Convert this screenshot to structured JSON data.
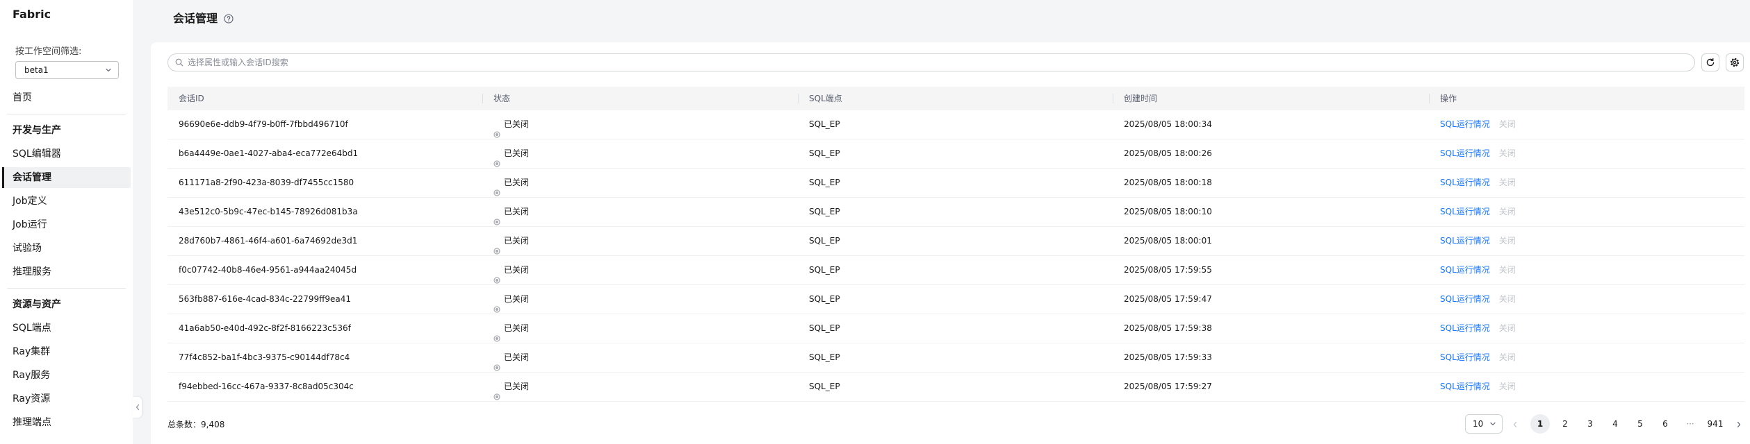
{
  "app": {
    "title": "Fabric"
  },
  "sidebar": {
    "workspace_filter_label": "按工作空间筛选:",
    "workspace_selected": "beta1",
    "home": "首页",
    "groups": [
      {
        "title": "开发与生产",
        "items": [
          {
            "label": "SQL编辑器",
            "active": false
          },
          {
            "label": "会话管理",
            "active": true
          },
          {
            "label": "Job定义",
            "active": false
          },
          {
            "label": "Job运行",
            "active": false
          },
          {
            "label": "试验场",
            "active": false
          },
          {
            "label": "推理服务",
            "active": false
          }
        ]
      },
      {
        "title": "资源与资产",
        "items": [
          {
            "label": "SQL端点",
            "active": false
          },
          {
            "label": "Ray集群",
            "active": false
          },
          {
            "label": "Ray服务",
            "active": false
          },
          {
            "label": "Ray资源",
            "active": false
          },
          {
            "label": "推理端点",
            "active": false
          }
        ]
      }
    ]
  },
  "page": {
    "title": "会话管理"
  },
  "search": {
    "placeholder": "选择属性或输入会话ID搜索"
  },
  "table": {
    "columns": [
      "会话ID",
      "状态",
      "SQL端点",
      "创建时间",
      "操作"
    ],
    "actions": {
      "sql_run": "SQL运行情况",
      "close": "关闭"
    },
    "rows": [
      {
        "id": "96690e6e-ddb9-4f79-b0ff-7fbbd496710f",
        "status": "已关闭",
        "endpoint": "SQL_EP",
        "created": "2025/08/05 18:00:34"
      },
      {
        "id": "b6a4449e-0ae1-4027-aba4-eca772e64bd1",
        "status": "已关闭",
        "endpoint": "SQL_EP",
        "created": "2025/08/05 18:00:26"
      },
      {
        "id": "611171a8-2f90-423a-8039-df7455cc1580",
        "status": "已关闭",
        "endpoint": "SQL_EP",
        "created": "2025/08/05 18:00:18"
      },
      {
        "id": "43e512c0-5b9c-47ec-b145-78926d081b3a",
        "status": "已关闭",
        "endpoint": "SQL_EP",
        "created": "2025/08/05 18:00:10"
      },
      {
        "id": "28d760b7-4861-46f4-a601-6a74692de3d1",
        "status": "已关闭",
        "endpoint": "SQL_EP",
        "created": "2025/08/05 18:00:01"
      },
      {
        "id": "f0c07742-40b8-46e4-9561-a944aa24045d",
        "status": "已关闭",
        "endpoint": "SQL_EP",
        "created": "2025/08/05 17:59:55"
      },
      {
        "id": "563fb887-616e-4cad-834c-22799ff9ea41",
        "status": "已关闭",
        "endpoint": "SQL_EP",
        "created": "2025/08/05 17:59:47"
      },
      {
        "id": "41a6ab50-e40d-492c-8f2f-8166223c536f",
        "status": "已关闭",
        "endpoint": "SQL_EP",
        "created": "2025/08/05 17:59:38"
      },
      {
        "id": "77f4c852-ba1f-4bc3-9375-c90144df78c4",
        "status": "已关闭",
        "endpoint": "SQL_EP",
        "created": "2025/08/05 17:59:33"
      },
      {
        "id": "f94ebbed-16cc-467a-9337-8c8ad05c304c",
        "status": "已关闭",
        "endpoint": "SQL_EP",
        "created": "2025/08/05 17:59:27"
      }
    ]
  },
  "footer": {
    "total_label": "总条数：",
    "total": "9,408"
  },
  "pagination": {
    "page_size": "10",
    "pages": [
      "1",
      "2",
      "3",
      "4",
      "5",
      "6"
    ],
    "ellipsis": "···",
    "last_page": "941",
    "current_page": 1
  },
  "icons": {
    "help": "help-icon",
    "search": "search-icon",
    "refresh": "refresh-icon",
    "settings": "gear-icon",
    "dropdown": "chevron-down-icon",
    "collapse": "chevron-left-icon",
    "status_closed": "status-closed-icon"
  },
  "colors": {
    "accent": "#1476ff",
    "text": "#191919",
    "muted": "#575d6c",
    "disabled": "#c0c4cc",
    "status_closed": "#a8abb2"
  }
}
